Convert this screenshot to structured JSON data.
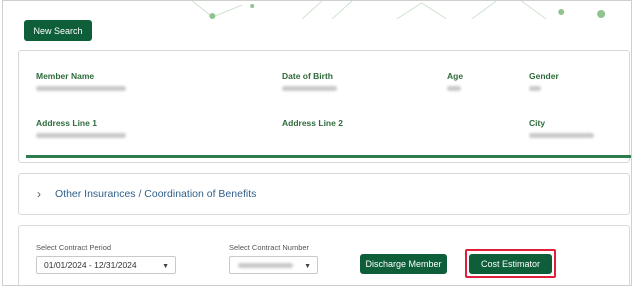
{
  "toolbar": {
    "new_search_label": "New Search"
  },
  "member": {
    "member_name_label": "Member Name",
    "dob_label": "Date of Birth",
    "age_label": "Age",
    "gender_label": "Gender",
    "address1_label": "Address Line 1",
    "address2_label": "Address Line 2",
    "city_label": "City"
  },
  "coordination": {
    "label": "Other Insurances / Coordination of Benefits"
  },
  "contract": {
    "period_caption": "Select Contract Period",
    "period_value": "01/01/2024 - 12/31/2024",
    "number_caption": "Select Contract Number",
    "discharge_label": "Discharge Member",
    "estimator_label": "Cost Estimator"
  },
  "colors": {
    "brand_green": "#0f5e3a",
    "highlight_red": "#e0203a",
    "link_blue": "#2e5f8a"
  }
}
